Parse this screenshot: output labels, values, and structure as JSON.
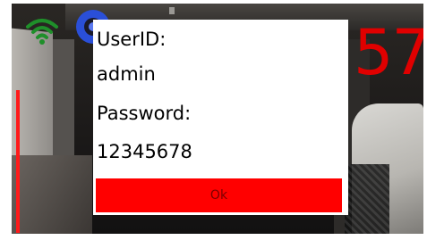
{
  "overlay": {
    "counter": "57",
    "wifi_icon": "wifi-icon",
    "record_icon": "record-icon",
    "accent_color": "#e00000",
    "wifi_color": "#1f8f2a",
    "record_color": "#2a4fd8"
  },
  "login_dialog": {
    "userid_label": "UserID:",
    "userid_value": "admin",
    "password_label": "Password:",
    "password_value": "12345678",
    "ok_label": "Ok",
    "button_color": "#ff0000"
  }
}
